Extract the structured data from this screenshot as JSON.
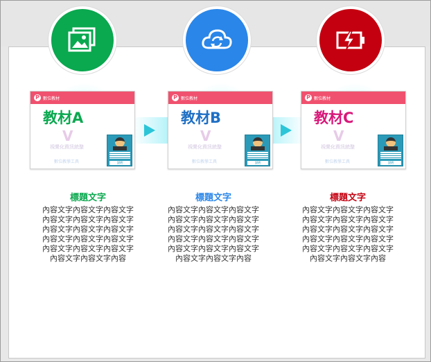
{
  "colors": {
    "green": "#0aa84f",
    "blue": "#2a86e8",
    "red": "#c40010",
    "card_header": "#f0516e",
    "arrow": "#2cc5d8"
  },
  "steps": [
    {
      "icon": "image-gallery-icon",
      "card_brand": "數位教材",
      "card_title": "教材A",
      "card_sub": "視覺化資訊統整",
      "card_sub2": "數位教學工具",
      "card_button": "說明",
      "heading": "標題文字",
      "content": "內容文字內容文字內容文字內容文字內容文字內容文字內容文字內容文字內容文字內容文字內容文字內容文字內容文字內容文字內容文字內容文字內容文字內容"
    },
    {
      "icon": "cloud-sync-icon",
      "card_brand": "數位教材",
      "card_title": "教材B",
      "card_sub": "視覺化資訊統整",
      "card_sub2": "數位教學工具",
      "card_button": "說明",
      "heading": "標題文字",
      "content": "內容文字內容文字內容文字內容文字內容文字內容文字內容文字內容文字內容文字內容文字內容文字內容文字內容文字內容文字內容文字內容文字內容文字內容"
    },
    {
      "icon": "battery-charging-icon",
      "card_brand": "數位教材",
      "card_title": "教材C",
      "card_sub": "視覺化資訊統整",
      "card_sub2": "數位教學工具",
      "card_button": "說明",
      "heading": "標題文字",
      "content": "內容文字內容文字內容文字內容文字內容文字內容文字內容文字內容文字內容文字內容文字內容文字內容文字內容文字內容文字內容文字內容文字內容文字內容"
    }
  ]
}
